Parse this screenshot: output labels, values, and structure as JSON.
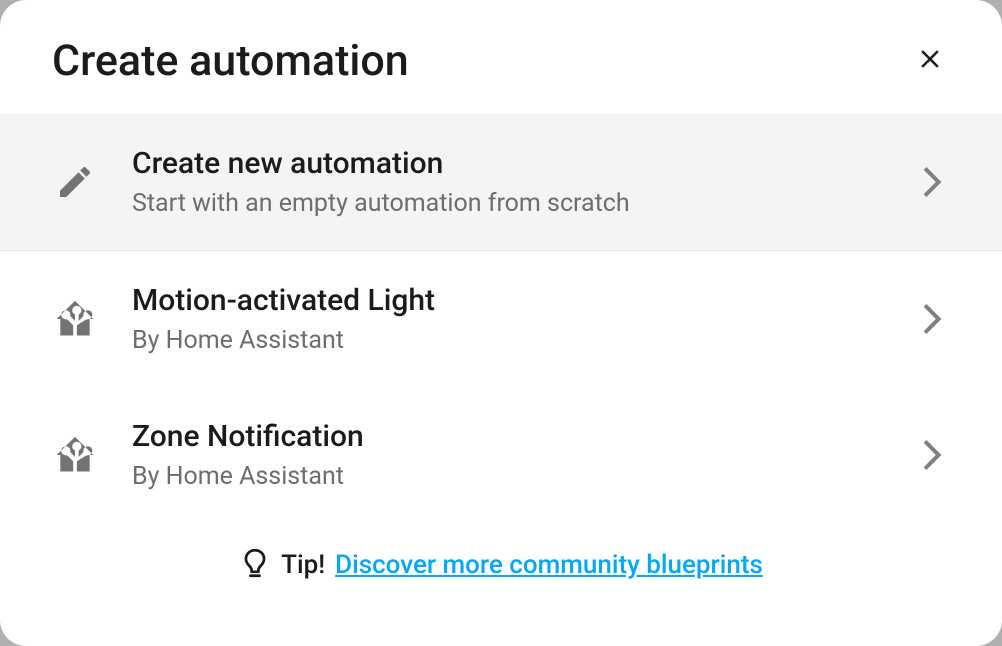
{
  "dialog": {
    "title": "Create automation"
  },
  "options": [
    {
      "icon": "pencil-icon",
      "title": "Create new automation",
      "subtitle": "Start with an empty automation from scratch",
      "highlight": true
    },
    {
      "icon": "home-assistant-icon",
      "title": "Motion-activated Light",
      "subtitle": "By Home Assistant",
      "highlight": false
    },
    {
      "icon": "home-assistant-icon",
      "title": "Zone Notification",
      "subtitle": "By Home Assistant",
      "highlight": false
    }
  ],
  "tip": {
    "label": "Tip!",
    "link_text": "Discover more community blueprints"
  },
  "colors": {
    "accent": "#03a9f4",
    "highlight_bg": "#f4f4f4",
    "text_primary": "#1b1b1b",
    "text_secondary": "#6d6d6d"
  }
}
